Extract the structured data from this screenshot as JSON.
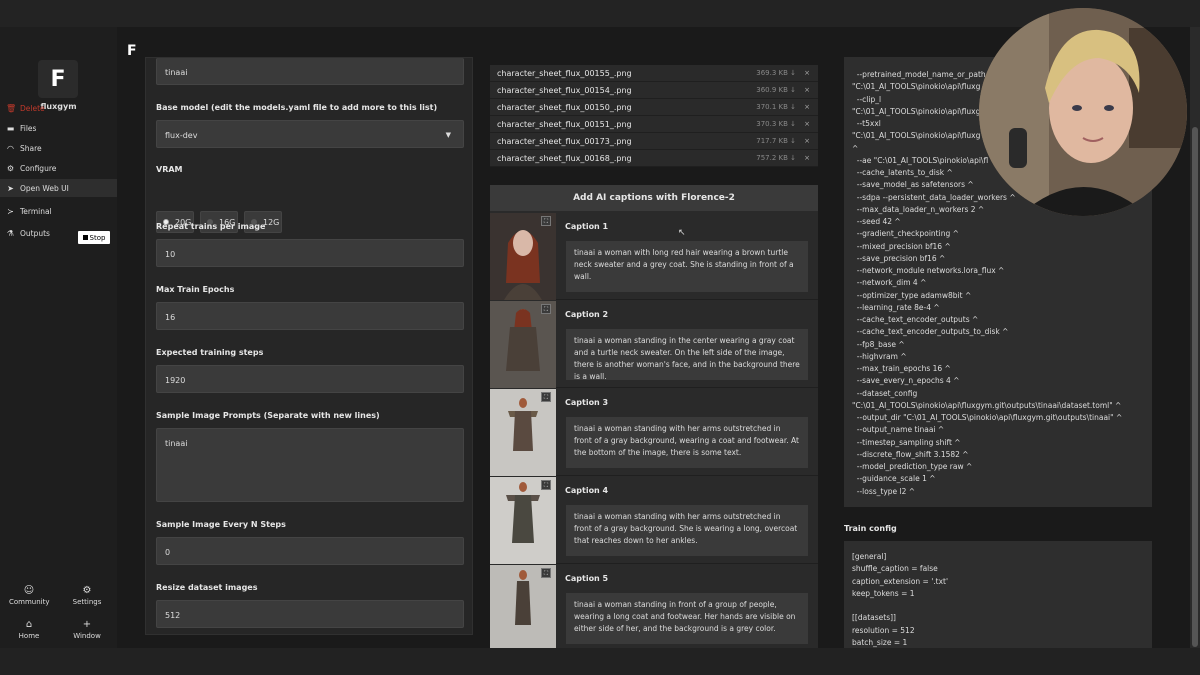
{
  "app": {
    "name": "fluxgym"
  },
  "sidebar": {
    "items": [
      {
        "label": "Delete",
        "icon": "trash-icon"
      },
      {
        "label": "Files",
        "icon": "folder-icon"
      },
      {
        "label": "Share",
        "icon": "wifi-icon"
      },
      {
        "label": "Configure",
        "icon": "gear-icon"
      },
      {
        "label": "Open Web UI",
        "icon": "rocket-icon"
      },
      {
        "label": "Terminal",
        "icon": "terminal-icon"
      },
      {
        "label": "Outputs",
        "icon": "flask-icon"
      }
    ],
    "stop_label": "Stop",
    "bottom": {
      "community": "Community",
      "settings": "Settings",
      "home": "Home",
      "window": "Window"
    }
  },
  "settings": {
    "trigger_word": "tinaai",
    "base_model_label": "Base model (edit the models.yaml file to add more to this list)",
    "base_model_value": "flux-dev",
    "vram_label": "VRAM",
    "vram_options": [
      "20G",
      "16G",
      "12G"
    ],
    "vram_selected": "20G",
    "repeat_label": "Repeat trains per image",
    "repeat_value": "10",
    "epochs_label": "Max Train Epochs",
    "epochs_value": "16",
    "steps_label": "Expected training steps",
    "steps_value": "1920",
    "prompts_label": "Sample Image Prompts (Separate with new lines)",
    "prompts_value": "tinaai",
    "every_n_label": "Sample Image Every N Steps",
    "every_n_value": "0",
    "resize_label": "Resize dataset images",
    "resize_value": "512"
  },
  "files": [
    {
      "name": "character_sheet_flux_00155_.png",
      "size": "369.3 KB ↓"
    },
    {
      "name": "character_sheet_flux_00154_.png",
      "size": "360.9 KB ↓"
    },
    {
      "name": "character_sheet_flux_00150_.png",
      "size": "370.1 KB ↓"
    },
    {
      "name": "character_sheet_flux_00151_.png",
      "size": "370.3 KB ↓"
    },
    {
      "name": "character_sheet_flux_00173_.png",
      "size": "717.7 KB ↓"
    },
    {
      "name": "character_sheet_flux_00168_.png",
      "size": "757.2 KB ↓"
    }
  ],
  "captions": {
    "title": "Add AI captions with Florence-2",
    "items": [
      {
        "label": "Caption 1",
        "text": "tinaai a woman with long red hair wearing a brown turtle neck sweater and a grey coat. She is standing in front of a wall."
      },
      {
        "label": "Caption 2",
        "text": "tinaai a woman standing in the center wearing a gray coat and a turtle neck sweater. On the left side of the image, there is another woman's face, and in the background there is a wall."
      },
      {
        "label": "Caption 3",
        "text": "tinaai a woman standing with her arms outstretched in front of a gray background, wearing a coat and footwear. At the bottom of the image, there is some text."
      },
      {
        "label": "Caption 4",
        "text": "tinaai a woman standing with her arms outstretched in front of a gray background. She is wearing a long, overcoat that reaches down to her ankles."
      },
      {
        "label": "Caption 5",
        "text": "tinaai a woman standing in front of a group of people, wearing a long coat and footwear. Her hands are visible on either side of her, and the background is a grey color."
      }
    ]
  },
  "command": "  --pretrained_model_name_or_path\n\"C:\\01_AI_TOOLS\\pinokio\\api\\fluxg\n  --clip_l\n\"C:\\01_AI_TOOLS\\pinokio\\api\\fluxg\n  --t5xxl\n\"C:\\01_AI_TOOLS\\pinokio\\api\\fluxg\n^\n  --ae \"C:\\01_AI_TOOLS\\pinokio\\api\\fl\n  --cache_latents_to_disk ^\n  --save_model_as safetensors ^\n  --sdpa --persistent_data_loader_workers ^\n  --max_data_loader_n_workers 2 ^\n  --seed 42 ^\n  --gradient_checkpointing ^\n  --mixed_precision bf16 ^\n  --save_precision bf16 ^\n  --network_module networks.lora_flux ^\n  --network_dim 4 ^\n  --optimizer_type adamw8bit ^\n  --learning_rate 8e-4 ^\n  --cache_text_encoder_outputs ^\n  --cache_text_encoder_outputs_to_disk ^\n  --fp8_base ^\n  --highvram ^\n  --max_train_epochs 16 ^\n  --save_every_n_epochs 4 ^\n  --dataset_config\n\"C:\\01_AI_TOOLS\\pinokio\\api\\fluxgym.git\\outputs\\tinaai\\dataset.toml\" ^\n  --output_dir \"C:\\01_AI_TOOLS\\pinokio\\api\\fluxgym.git\\outputs\\tinaai\" ^\n  --output_name tinaai ^\n  --timestep_sampling shift ^\n  --discrete_flow_shift 3.1582 ^\n  --model_prediction_type raw ^\n  --guidance_scale 1 ^\n  --loss_type l2 ^",
  "train_config": {
    "label": "Train config",
    "text": "[general]\nshuffle_caption = false\ncaption_extension = '.txt'\nkeep_tokens = 1\n\n[[datasets]]\nresolution = 512\nbatch_size = 1"
  }
}
